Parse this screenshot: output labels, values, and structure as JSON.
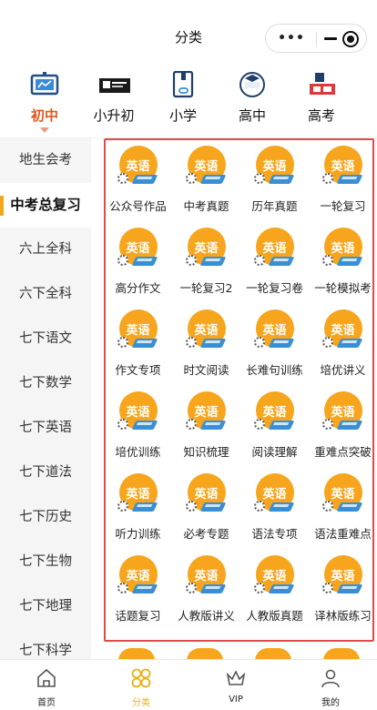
{
  "header": {
    "title": "分类",
    "menu_dots": "•••"
  },
  "levels": [
    {
      "label": "初中",
      "icon": "chalkboard-icon",
      "active": true
    },
    {
      "label": "小升初",
      "icon": "banner-icon",
      "active": false
    },
    {
      "label": "小学",
      "icon": "book-link-icon",
      "active": false
    },
    {
      "label": "高中",
      "icon": "graduation-badge-icon",
      "active": false
    },
    {
      "label": "高考",
      "icon": "gaokao-icon",
      "active": false
    }
  ],
  "sidebar": {
    "items": [
      {
        "label": "地生会考"
      },
      {
        "label": "中考总复习",
        "active": true
      },
      {
        "label": "六上全科"
      },
      {
        "label": "六下全科"
      },
      {
        "label": "七下语文"
      },
      {
        "label": "七下数学"
      },
      {
        "label": "七下英语"
      },
      {
        "label": "七下道法"
      },
      {
        "label": "七下历史"
      },
      {
        "label": "七下生物"
      },
      {
        "label": "七下地理"
      },
      {
        "label": "七下科学"
      }
    ]
  },
  "grid": {
    "badge_text": "英语",
    "items": [
      "公众号作品",
      "中考真题",
      "历年真题",
      "一轮复习",
      "高分作文",
      "一轮复习2",
      "一轮复习卷",
      "一轮模拟考",
      "作文专项",
      "时文阅读",
      "长难句训练",
      "培优讲义",
      "培优训练",
      "知识梳理",
      "阅读理解",
      "重难点突破",
      "听力训练",
      "必考专题",
      "语法专项",
      "语法重难点",
      "话题复习",
      "人教版讲义",
      "人教版真题",
      "译林版练习"
    ]
  },
  "tabbar": [
    {
      "label": "首页",
      "icon": "home-icon",
      "active": false
    },
    {
      "label": "分类",
      "icon": "category-icon",
      "active": true
    },
    {
      "label": "VIP",
      "icon": "crown-icon",
      "active": false
    },
    {
      "label": "我的",
      "icon": "user-icon",
      "active": false
    }
  ],
  "colors": {
    "accent_orange": "#e0561d",
    "badge": "#f7a51c",
    "highlight_frame": "#e04a4a",
    "tab_active": "#e6b21a"
  }
}
